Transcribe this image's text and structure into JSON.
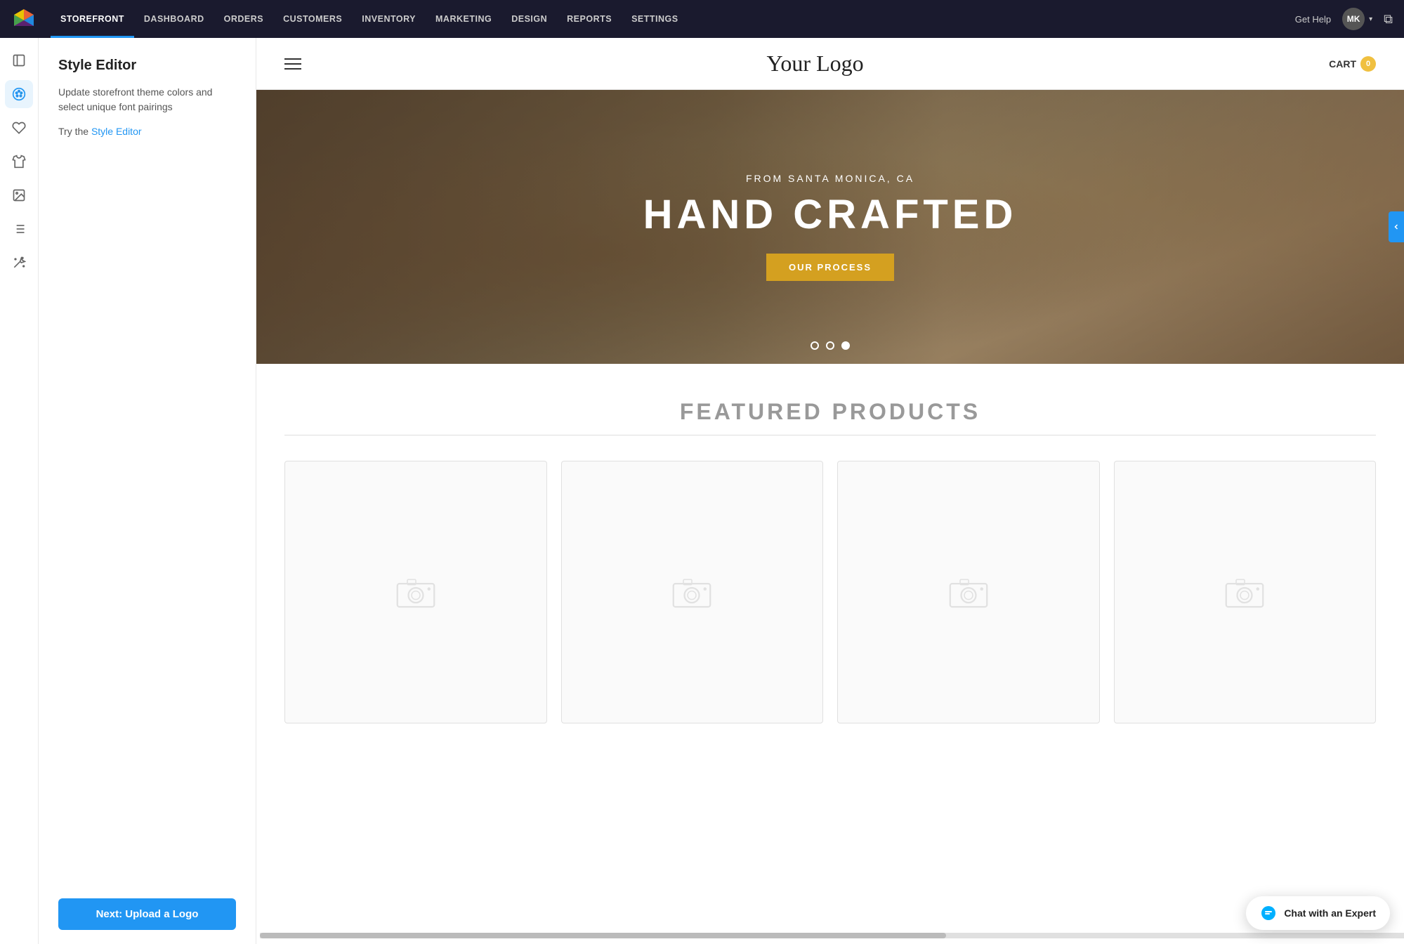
{
  "topNav": {
    "items": [
      {
        "label": "STOREFRONT",
        "active": true
      },
      {
        "label": "DASHBOARD",
        "active": false
      },
      {
        "label": "ORDERS",
        "active": false
      },
      {
        "label": "CUSTOMERS",
        "active": false
      },
      {
        "label": "INVENTORY",
        "active": false
      },
      {
        "label": "MARKETING",
        "active": false
      },
      {
        "label": "DESIGN",
        "active": false
      },
      {
        "label": "REPORTS",
        "active": false
      },
      {
        "label": "SETTINGS",
        "active": false
      }
    ],
    "getHelp": "Get Help",
    "userInitials": "MK"
  },
  "sidebarIcons": [
    {
      "name": "pages-icon",
      "symbol": "📄"
    },
    {
      "name": "palette-icon",
      "symbol": "🎨",
      "active": true
    },
    {
      "name": "heart-icon",
      "symbol": "♡"
    },
    {
      "name": "tshirt-icon",
      "symbol": "👕"
    },
    {
      "name": "image-icon",
      "symbol": "🖼"
    },
    {
      "name": "list-icon",
      "symbol": "☰"
    },
    {
      "name": "wand-icon",
      "symbol": "✨"
    }
  ],
  "styleEditor": {
    "title": "Style Editor",
    "description": "Update storefront theme colors and select unique font pairings",
    "tryText": "Try the",
    "linkText": "Style Editor",
    "nextButton": "Next: Upload a Logo"
  },
  "storefrontPreview": {
    "logoText": "Your Logo",
    "cartLabel": "CART",
    "cartCount": "0",
    "hero": {
      "subtitle": "FROM SANTA MONICA, CA",
      "title": "HAND CRAFTED",
      "buttonLabel": "OUR PROCESS",
      "dots": [
        false,
        false,
        true
      ]
    },
    "featuredProducts": {
      "title": "FEATURED PRODUCTS",
      "products": [
        {},
        {},
        {},
        {}
      ]
    }
  },
  "chat": {
    "label": "Chat with an Expert"
  }
}
